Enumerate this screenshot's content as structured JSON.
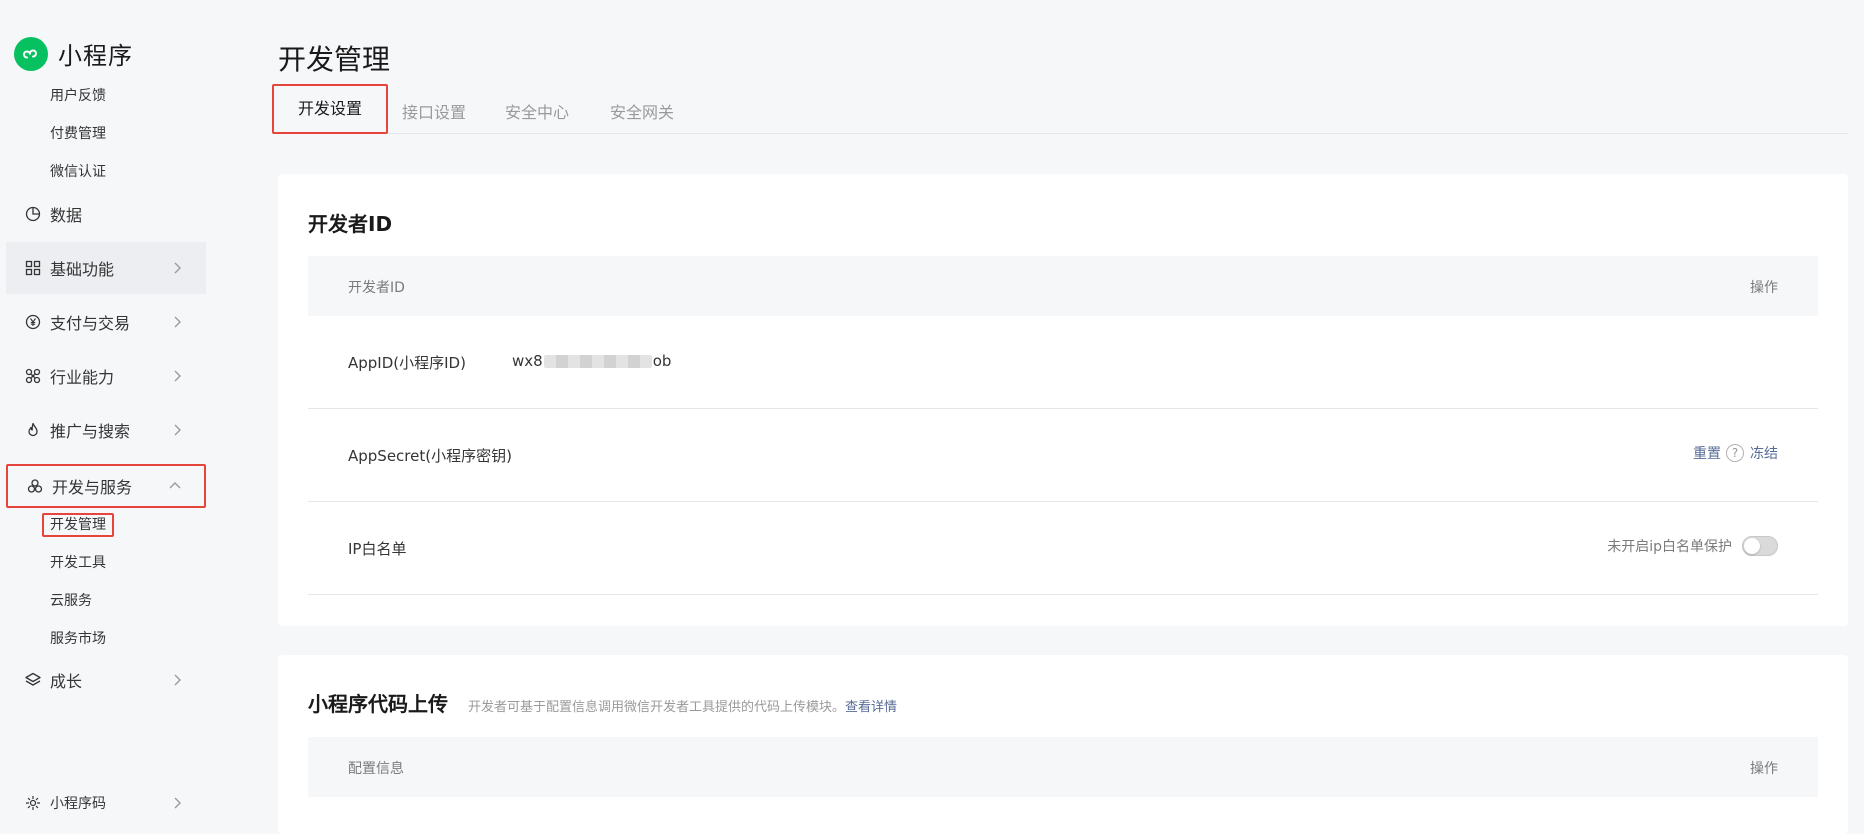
{
  "sidebar": {
    "brand": "小程序",
    "top_subitems": [
      "用户反馈",
      "付费管理",
      "微信认证"
    ],
    "nav": {
      "data": "数据",
      "basic": "基础功能",
      "payment": "支付与交易",
      "industry": "行业能力",
      "promotion": "推广与搜索",
      "dev": "开发与服务",
      "growth": "成长",
      "qrcode": "小程序码"
    },
    "dev_subitems": [
      "开发管理",
      "开发工具",
      "云服务",
      "服务市场"
    ]
  },
  "main": {
    "title": "开发管理",
    "tabs": [
      "开发设置",
      "接口设置",
      "安全中心",
      "安全网关"
    ],
    "developer_id": {
      "title": "开发者ID",
      "col_left": "开发者ID",
      "col_right": "操作",
      "appid_label": "AppID(小程序ID)",
      "appid_prefix": "wx8",
      "appid_suffix": "ob",
      "secret_label": "AppSecret(小程序密钥)",
      "reset": "重置",
      "help": "?",
      "freeze": "冻结",
      "ip_label": "IP白名单",
      "ip_status": "未开启ip白名单保护"
    },
    "upload": {
      "title": "小程序代码上传",
      "desc": "开发者可基于配置信息调用微信开发者工具提供的代码上传模块。",
      "detail_link": "查看详情",
      "col_left": "配置信息",
      "col_right": "操作"
    }
  },
  "colors": {
    "brand": "#07c160",
    "link": "#576b95",
    "highlight": "#e6453c"
  }
}
